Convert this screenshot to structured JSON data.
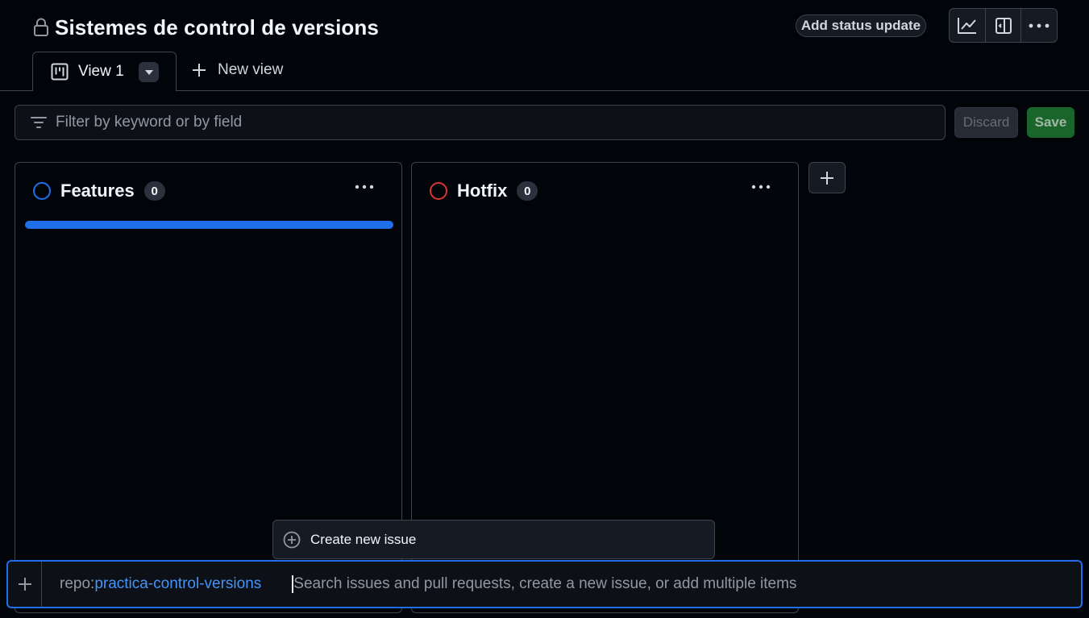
{
  "header": {
    "title": "Sistemes de control de versions",
    "status_button": "Add status update",
    "icons": [
      "lock-icon",
      "graph-icon",
      "sidebar-icon",
      "kebab-horizontal-icon"
    ]
  },
  "tabs": {
    "active": {
      "label": "View 1",
      "icon": "project-board-icon"
    },
    "new_view_label": "New view"
  },
  "filter": {
    "placeholder": "Filter by keyword or by field",
    "value": "",
    "discard_label": "Discard",
    "save_label": "Save"
  },
  "columns": [
    {
      "name": "Features",
      "count": "0",
      "color": "#1f6feb"
    },
    {
      "name": "Hotfix",
      "count": "0",
      "color": "#da3633"
    }
  ],
  "popup": {
    "create_issue_label": "Create new issue"
  },
  "add_item": {
    "repo_prefix": "repo:",
    "repo_name": "practica-control-versions",
    "placeholder": "Search issues and pull requests, create a new issue, or add multiple items",
    "value": ""
  },
  "colors": {
    "background": "#010409",
    "border": "#3d444d",
    "accent": "#1f6feb",
    "save_green": "#238636",
    "link_blue": "#4493f8"
  }
}
